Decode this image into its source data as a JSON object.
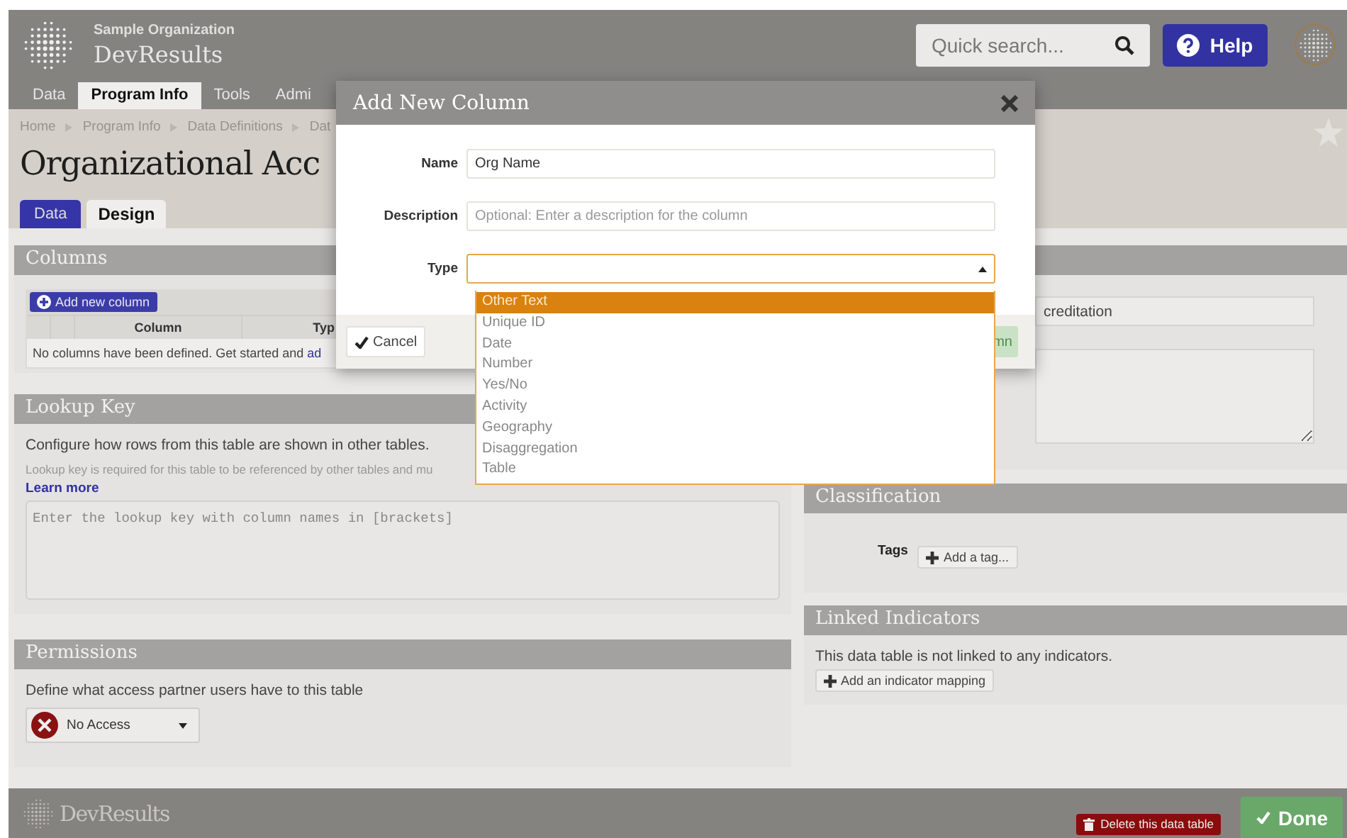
{
  "header": {
    "organization": "Sample Organization",
    "app_name": "DevResults",
    "search": {
      "placeholder": "Quick search..."
    },
    "help_button": "Help"
  },
  "nav": [
    {
      "label": "Data",
      "selected": false
    },
    {
      "label": "Program Info",
      "selected": true
    },
    {
      "label": "Tools",
      "selected": false
    },
    {
      "label": "Admi",
      "selected": false
    }
  ],
  "breadcrumb": [
    "Home",
    "Program Info",
    "Data Definitions",
    "Dat"
  ],
  "page_title": "Organizational Acc",
  "view_tabs": [
    {
      "label": "Data",
      "selected": false
    },
    {
      "label": "Design",
      "selected": true
    }
  ],
  "columns_section": {
    "title": "Columns",
    "add_button": "Add new column",
    "headers": [
      "Column",
      "Typ"
    ],
    "empty_text": "No columns have been defined. Get started and ",
    "empty_link": "ad"
  },
  "lookup_key": {
    "title": "Lookup Key",
    "description": "Configure how rows from this table are shown in other tables.",
    "note": "Lookup key is required for this table to be referenced by other tables and mu",
    "link": "Learn more",
    "placeholder": "Enter the lookup key with column names in [brackets]"
  },
  "permissions": {
    "title": "Permissions",
    "description": "Define what access partner users have to this table",
    "access": "No Access"
  },
  "details": {
    "name_value": "creditation"
  },
  "classification": {
    "title": "Classification",
    "tags_label": "Tags",
    "add_tag": "Add a tag..."
  },
  "linked_indicators": {
    "title": "Linked Indicators",
    "description": "This data table is not linked to any indicators.",
    "add_button": "Add an indicator mapping"
  },
  "footer": {
    "brand": "DevResults",
    "delete_button": "Delete this data table",
    "done_button": "Done"
  },
  "dialog": {
    "title": "Add New Column",
    "fields": [
      {
        "label": "Name",
        "value": "Org Name"
      },
      {
        "label": "Description",
        "placeholder": "Optional: Enter a description for the column"
      }
    ],
    "type_label": "Type",
    "type_options": [
      {
        "label": "Other Text",
        "selected": true
      },
      {
        "label": "Unique ID",
        "selected": false
      },
      {
        "label": "Date",
        "selected": false
      },
      {
        "label": "Number",
        "selected": false
      },
      {
        "label": "Yes/No",
        "selected": false
      },
      {
        "label": "Activity",
        "selected": false
      },
      {
        "label": "Geography",
        "selected": false
      },
      {
        "label": "Disaggregation",
        "selected": false
      },
      {
        "label": "Table",
        "selected": false
      }
    ],
    "cancel_button": "Cancel",
    "submit_button": "mn"
  }
}
